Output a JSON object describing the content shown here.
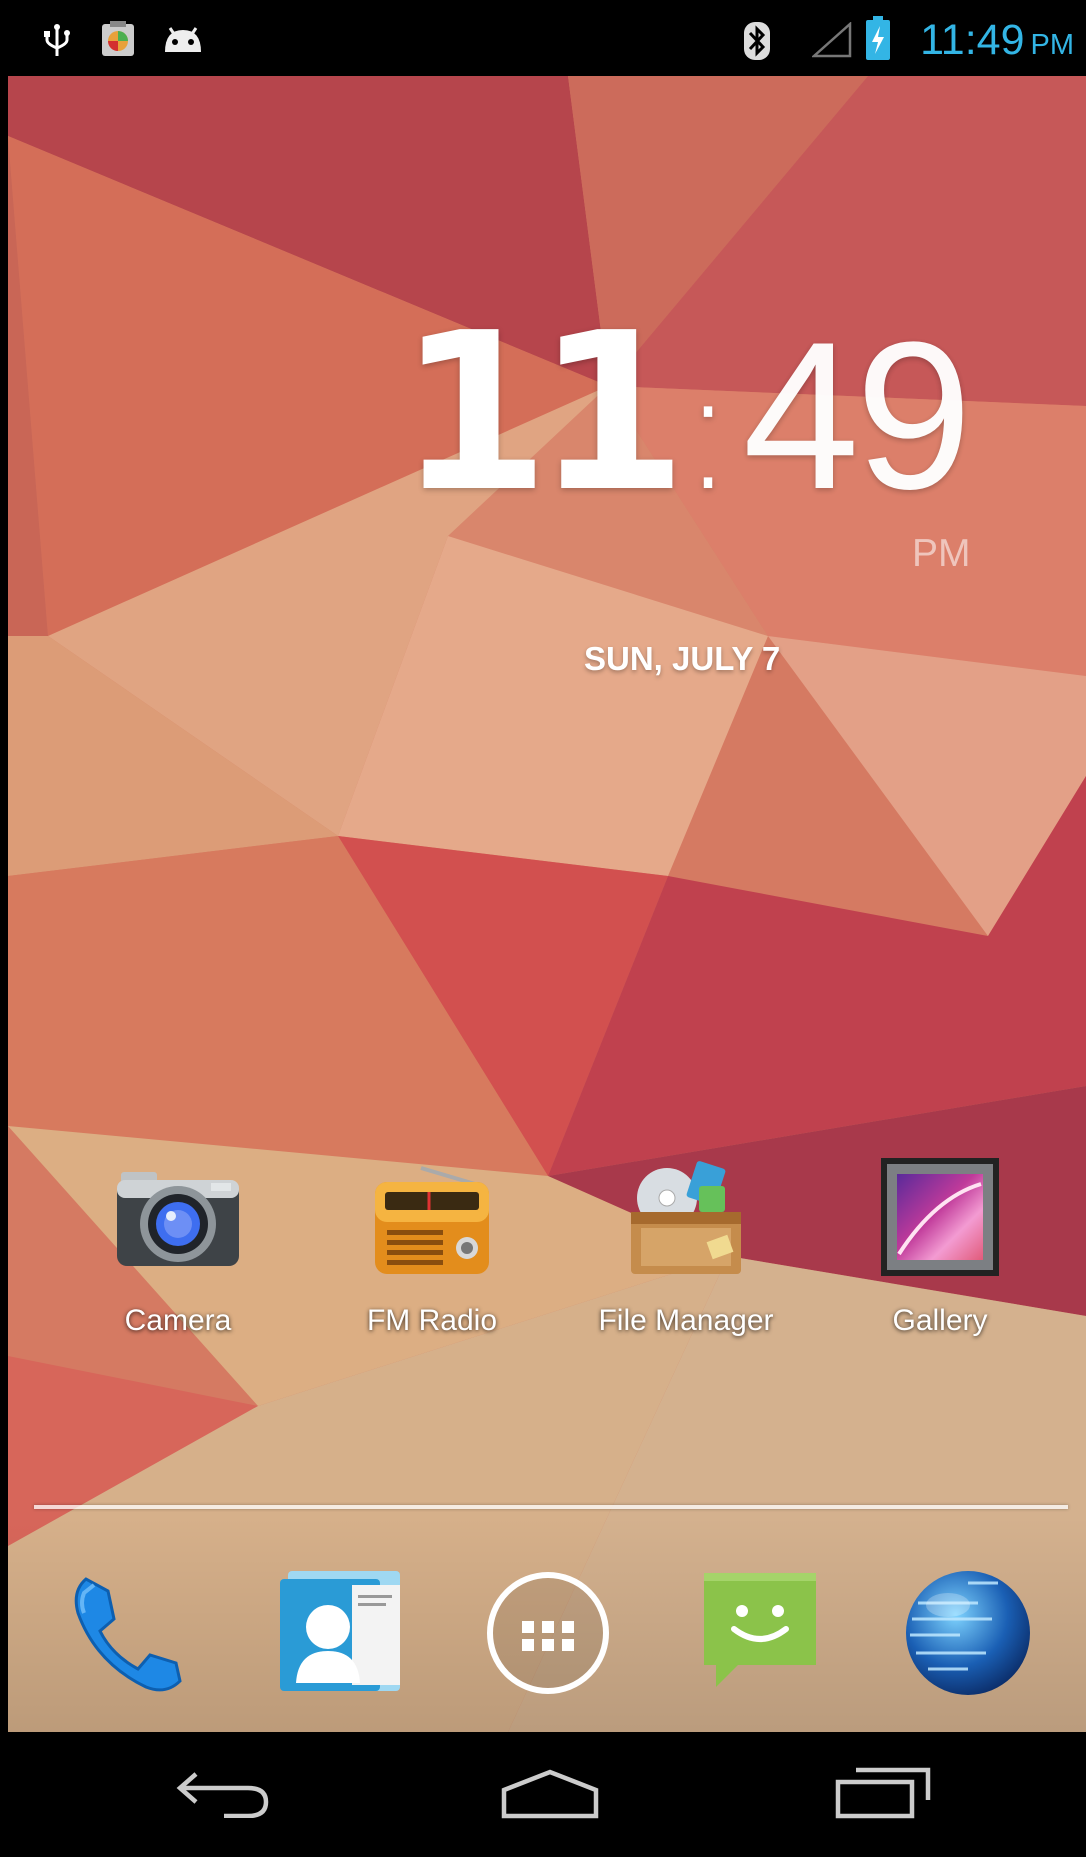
{
  "status_bar": {
    "left_icons": [
      "usb-icon",
      "notification-app-icon",
      "android-icon"
    ],
    "right_icons": [
      "bluetooth-icon",
      "signal-icon",
      "battery-charging-icon"
    ],
    "time": "11:49",
    "ampm": "PM",
    "accent_color": "#33b5e5"
  },
  "clock_widget": {
    "hours": "11",
    "colon": ":",
    "minutes": "49",
    "ampm": "PM",
    "date": "SUN, JULY 7"
  },
  "apps": [
    {
      "label": "Camera",
      "icon": "camera-icon"
    },
    {
      "label": "FM Radio",
      "icon": "radio-icon"
    },
    {
      "label": "File Manager",
      "icon": "file-manager-icon"
    },
    {
      "label": "Gallery",
      "icon": "gallery-icon"
    }
  ],
  "dock": [
    "phone-icon",
    "contacts-icon",
    "app-drawer-icon",
    "messaging-icon",
    "browser-icon"
  ],
  "nav_bar": [
    "back-icon",
    "home-icon",
    "recent-apps-icon"
  ]
}
